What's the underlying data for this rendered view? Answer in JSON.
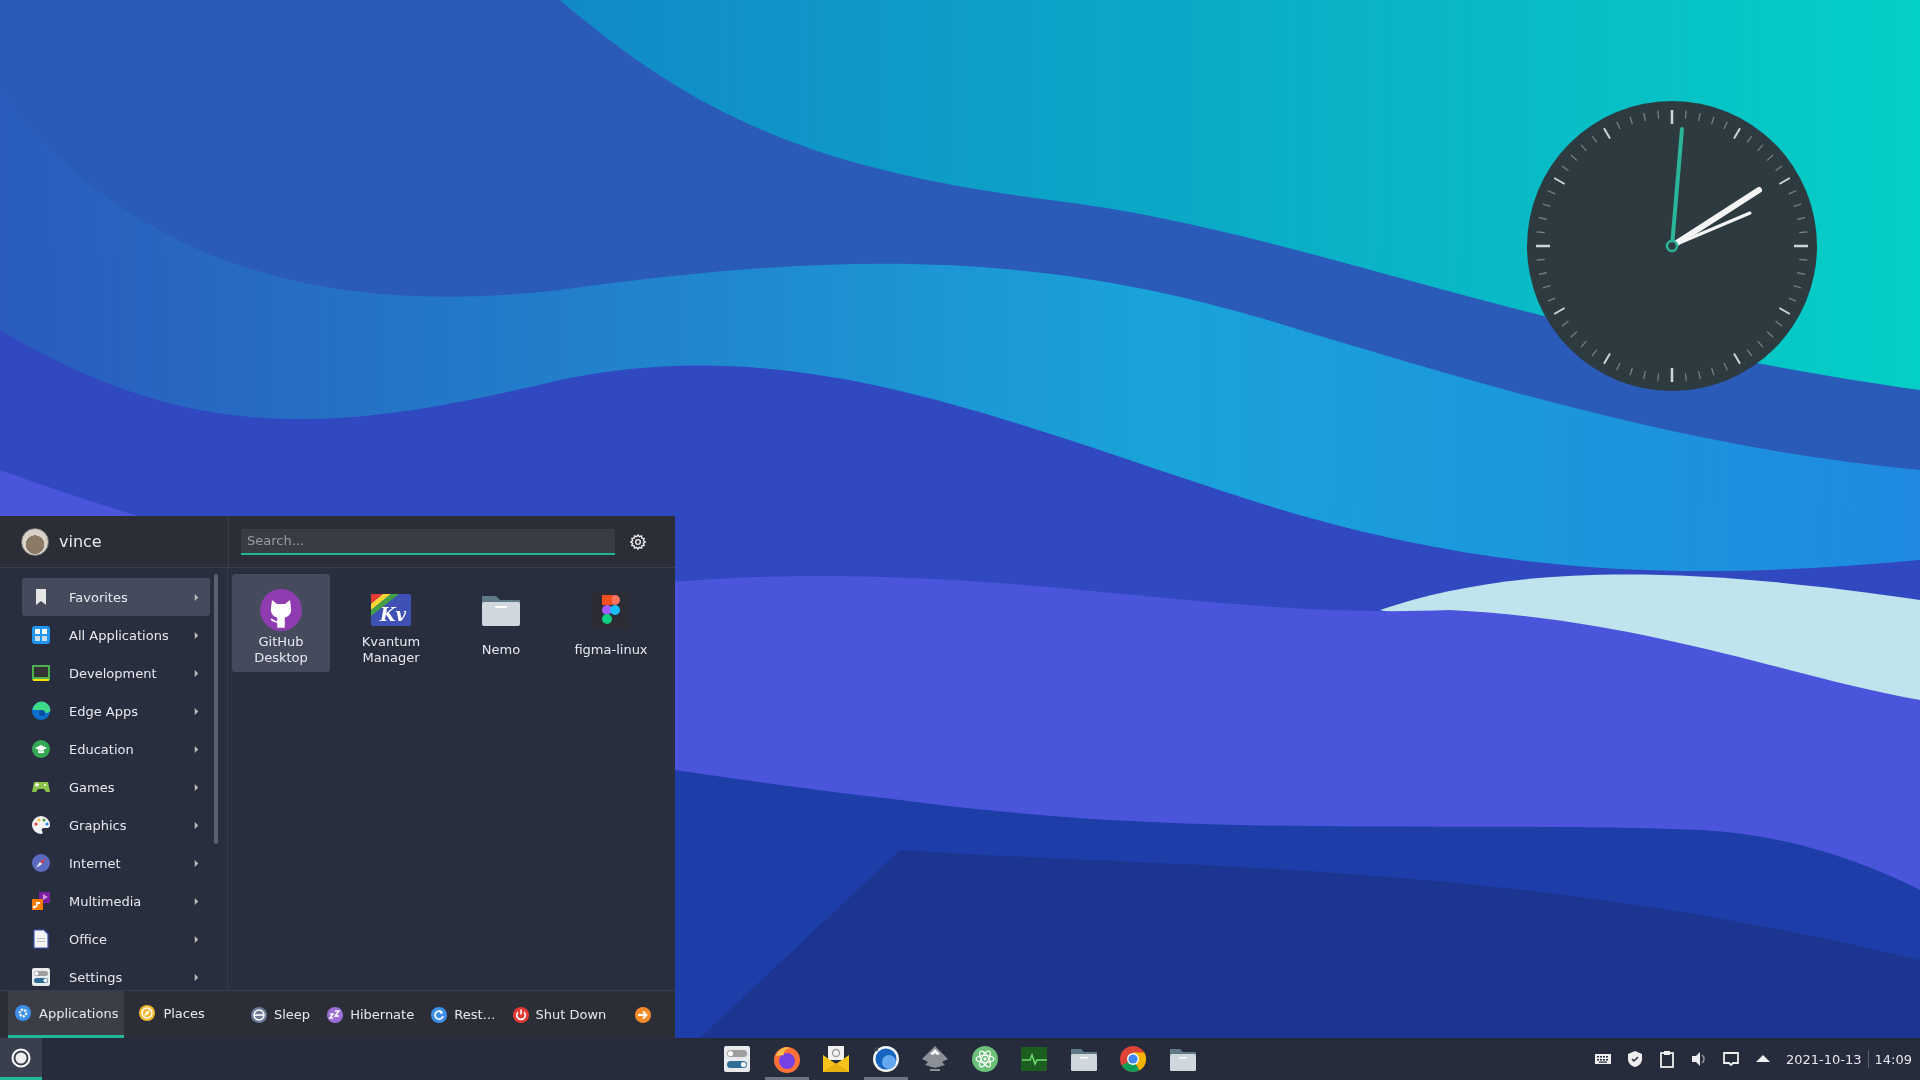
{
  "menu": {
    "user": {
      "name": "vince"
    },
    "search": {
      "placeholder": "Search..."
    },
    "categories": [
      {
        "label": "Favorites",
        "kind": "favorites",
        "selected": true
      },
      {
        "label": "All Applications",
        "kind": "all",
        "selected": false
      },
      {
        "label": "Development",
        "kind": "development",
        "selected": false
      },
      {
        "label": "Edge Apps",
        "kind": "edge",
        "selected": false
      },
      {
        "label": "Education",
        "kind": "education",
        "selected": false
      },
      {
        "label": "Games",
        "kind": "games",
        "selected": false
      },
      {
        "label": "Graphics",
        "kind": "graphics",
        "selected": false
      },
      {
        "label": "Internet",
        "kind": "internet",
        "selected": false
      },
      {
        "label": "Multimedia",
        "kind": "multimedia",
        "selected": false
      },
      {
        "label": "Office",
        "kind": "office",
        "selected": false
      },
      {
        "label": "Settings",
        "kind": "settings",
        "selected": false
      }
    ],
    "apps": [
      {
        "label": "GitHub Desktop",
        "kind": "github",
        "selected": true
      },
      {
        "label": "Kvantum Manager",
        "kind": "kvantum",
        "logo_text": "Kv",
        "selected": false
      },
      {
        "label": "Nemo",
        "kind": "folder",
        "selected": false
      },
      {
        "label": "figma-linux",
        "kind": "figma",
        "selected": false
      }
    ],
    "bottom_tabs": [
      {
        "label": "Applications",
        "kind": "applications",
        "selected": true
      },
      {
        "label": "Places",
        "kind": "places",
        "selected": false
      }
    ],
    "session_buttons": [
      {
        "label": "Sleep",
        "kind": "sleep"
      },
      {
        "label": "Hibernate",
        "kind": "hibernate"
      },
      {
        "label": "Rest…",
        "kind": "restart"
      },
      {
        "label": "Shut Down",
        "kind": "shutdown"
      }
    ]
  },
  "taskbar": {
    "launchers": [
      {
        "kind": "toggles",
        "running": false
      },
      {
        "kind": "firefox",
        "running": true
      },
      {
        "kind": "mail",
        "running": false
      },
      {
        "kind": "disc",
        "running": true
      },
      {
        "kind": "inkscape",
        "running": false
      },
      {
        "kind": "atom",
        "running": false
      },
      {
        "kind": "sysmon",
        "running": false
      },
      {
        "kind": "folder",
        "running": false
      },
      {
        "kind": "chrome",
        "running": false
      },
      {
        "kind": "folder",
        "running": false
      }
    ],
    "tray": {
      "date": "2021-10-13",
      "time": "14:09"
    }
  }
}
